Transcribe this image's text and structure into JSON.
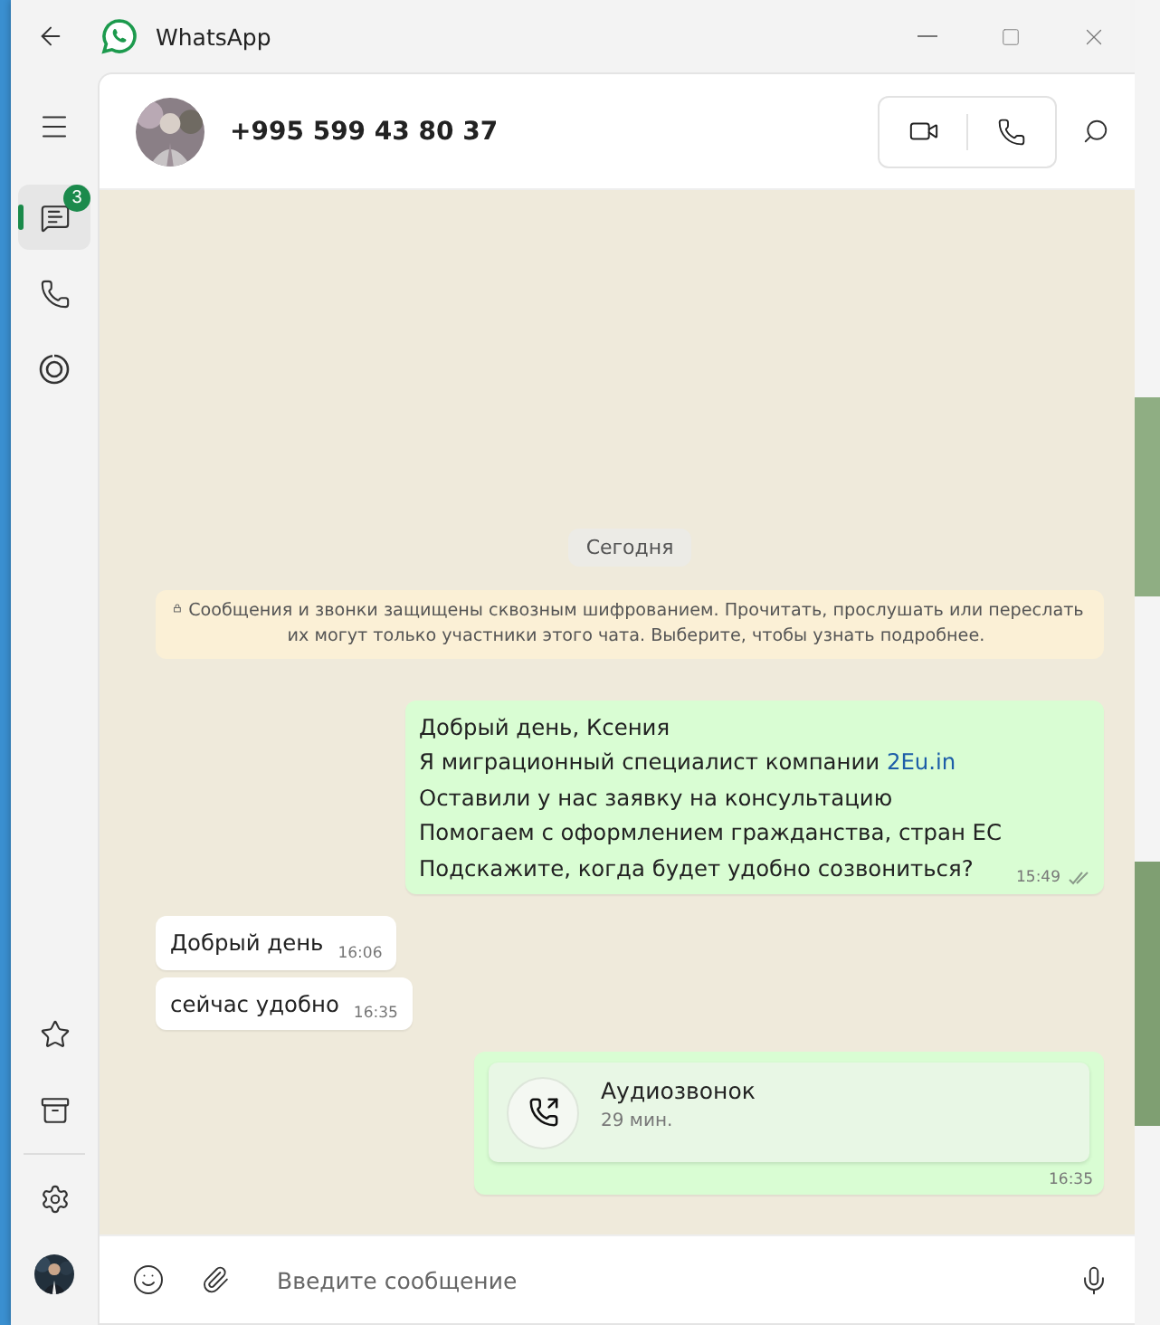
{
  "window": {
    "title": "WhatsApp"
  },
  "nav": {
    "top": [
      {
        "kind": "chats",
        "selected": true,
        "badge": "3"
      },
      {
        "kind": "calls",
        "selected": false
      },
      {
        "kind": "status",
        "selected": false
      }
    ],
    "bottom": [
      {
        "kind": "starred",
        "selected": false
      },
      {
        "kind": "archive",
        "selected": false
      },
      {
        "kind": "settings",
        "selected": false
      },
      {
        "kind": "profile",
        "selected": false
      }
    ]
  },
  "chat": {
    "contact": "+995 599 43 80 37",
    "date": "Сегодня",
    "notice": "Сообщения и звонки защищены сквозным шифрованием. Прочитать, прослушать или переслать их могут только участники этого чата. Выберите, чтобы узнать подробнее.",
    "messages": [
      {
        "kind": "text",
        "outgoing": true,
        "time": "15:49",
        "read": false,
        "lines": [
          {
            "text": "Добрый день, Ксения"
          },
          {
            "text": "Я миграционный специалист компании ",
            "link": "2Eu.in"
          },
          {
            "text": "Оставили у нас заявку на консультацию"
          },
          {
            "text": "Помогаем с оформлением гражданства, стран ЕС"
          },
          {
            "text": "Подскажите, когда будет удобно созвониться?"
          }
        ]
      },
      {
        "kind": "text",
        "outgoing": false,
        "time": "16:06",
        "lines": [
          {
            "text": "Добрый день"
          }
        ]
      },
      {
        "kind": "text",
        "outgoing": false,
        "time": "16:35",
        "lines": [
          {
            "text": "сейчас удобно"
          }
        ]
      },
      {
        "kind": "call",
        "outgoing": true,
        "time": "16:35",
        "title": "Аудиозвонок",
        "duration": "29 мин."
      }
    ]
  },
  "composer": {
    "placeholder": "Введите сообщение"
  }
}
